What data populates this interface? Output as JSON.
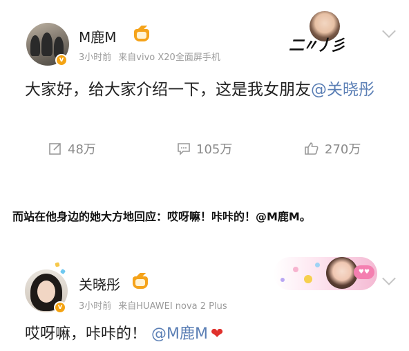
{
  "post1": {
    "author": "M鹿M",
    "time": "3小时前",
    "source": "来自vivo X20全面屏手机",
    "text_main": "大家好，给大家介绍一下，这是我女朋友",
    "mention": "@关晓彤",
    "actions": {
      "repost_count": "48万",
      "comment_count": "105万",
      "like_count": "270万"
    }
  },
  "caption": "而站在他身边的她大方地回应：哎呀嘛！咔咔的！@M鹿M。",
  "post2": {
    "author": "关晓彤",
    "time": "3小时前",
    "source": "来自HUAWEI nova 2 Plus",
    "text_main": "哎呀嘛，咔咔的！",
    "mention": "@M鹿M",
    "heart": "❤"
  },
  "badges": {
    "verified_label": "v",
    "crown_color": "#f5a31a",
    "verified_color": "#f4a312",
    "mention_color": "#5b7fb5"
  }
}
